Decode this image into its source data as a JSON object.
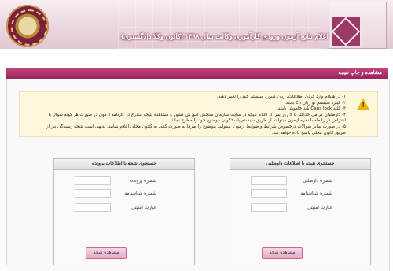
{
  "header": {
    "title": "اعلام نتایج آزمون ورودی کارآموزی وکالت سال ۱۳۹۸ (کانون وکلا دادگستری)"
  },
  "section": {
    "title": "مشاهده و چاپ نتیجه"
  },
  "notice": {
    "lines": [
      "۱- در هنگام وارد کردن اطلاعات، زبان کیبورد سیستم خود را تغییر دهید.",
      "۲- کیبرد سیستم تو زبان En باشد",
      "۳- کلید Caps lock باید خاموش باشد.",
      "۴- داوطلبان گرامی حداکثر تا 5 روز پس از اعلام نتیجه در سایت سازمان سنجش آموزش کشور و مشاهده نتیجه مندرج در کارنامه آزمون در صورت هر گونه سوال یا",
      "اعتراض در رابطه با نمره آزمون میتوانند از طریق سیستم پاسخگویی موضوع خود را مطرح نمایند.",
      "۵- در صورت سایر سوالات درخصوص شرایط و ضوابط آزمون، میتوانید موضوع را صرفا به صورت کتبی به کانون محلی اعلام نمایید، بدیهی است نتیجه رسیدگی نیز از",
      "طریق کانون محلی پاسخ داده خواهد شد."
    ]
  },
  "panel_applicant": {
    "title": "جستجوی نتیجه با اطلاعات داوطلبی",
    "field1_label": "شماره داوطلبی",
    "field2_label": "شماره شناسنامه",
    "field3_label": "عبارت امنیتی",
    "button_label": "مشاهده نتیجه"
  },
  "panel_case": {
    "title": "جستجوی نتیجه با اطلاعات پرونده",
    "field1_label": "شماره پرونده",
    "field2_label": "شماره شناسنامه",
    "field3_label": "عبارت امنیتی",
    "button_label": "مشاهده نتیجه"
  },
  "colors": {
    "accent": "#9a2457",
    "notice_bg": "#fdf8dc",
    "button_bg": "#e4a9c3"
  },
  "icons": {
    "notice": "warning-icon"
  }
}
